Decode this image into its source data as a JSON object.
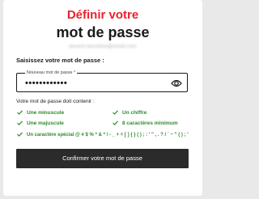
{
  "header": {
    "title_accent": "Définir votre",
    "title_main": "mot de passe",
    "email": "laurent.lanceline@email.com"
  },
  "form": {
    "prompt": "Saisissez votre mot de passe :",
    "field_label": "Nouveau mot de passe *",
    "field_value": "••••••••••••",
    "requirements_title": "Votre mot de passe doit contenir :",
    "requirements": [
      "Une minuscule",
      "Un chiffre",
      "Une majuscule",
      "8 caractères minimum",
      "Un caractère spécial @ # $ % * & * \\ - _ + = [ ] { } ( ) ; : ' \" , . ? / ` ~ \" ( ) ; '"
    ],
    "requirement_icon": "checkmark-icon",
    "requirement_color": "#2e8b2e",
    "submit_label": "Confirmer votre mot de passe"
  },
  "colors": {
    "accent": "#e8222e",
    "button": "#2b2b2b"
  }
}
